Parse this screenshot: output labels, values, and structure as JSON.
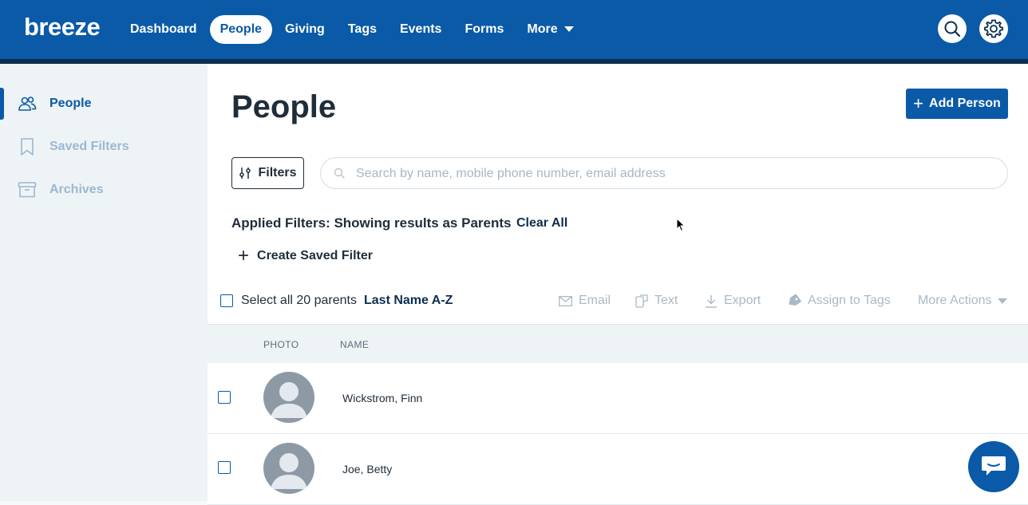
{
  "header": {
    "logo": "breeze",
    "nav": [
      {
        "label": "Dashboard",
        "active": false
      },
      {
        "label": "People",
        "active": true
      },
      {
        "label": "Giving",
        "active": false
      },
      {
        "label": "Tags",
        "active": false
      },
      {
        "label": "Events",
        "active": false
      },
      {
        "label": "Forms",
        "active": false
      },
      {
        "label": "More",
        "active": false
      }
    ],
    "icons": [
      "search-icon",
      "gear-icon"
    ]
  },
  "sidebar": {
    "items": [
      {
        "label": "People",
        "icon": "people-icon",
        "active": true
      },
      {
        "label": "Saved Filters",
        "icon": "bookmark-icon",
        "active": false
      },
      {
        "label": "Archives",
        "icon": "archive-box-icon",
        "active": false
      }
    ]
  },
  "main": {
    "title": "People",
    "add_button": "Add Person",
    "filters_button": "Filters",
    "search": {
      "placeholder": "Search by name, mobile phone number, email address",
      "value": ""
    },
    "applied_filters": "Applied Filters: Showing results as Parents",
    "clear_all": "Clear All",
    "create_saved_filter": "Create Saved Filter",
    "select_all": "Select all 20 parents",
    "sort": "Last Name A-Z",
    "actions": {
      "email": "Email",
      "text": "Text",
      "export": "Export",
      "assign_tags": "Assign to Tags",
      "more_actions": "More Actions"
    },
    "table": {
      "columns": [
        "PHOTO",
        "NAME"
      ],
      "rows": [
        {
          "name": "Wickstrom, Finn"
        },
        {
          "name": "Joe, Betty"
        }
      ]
    }
  },
  "colors": {
    "brand": "#0a5aa8",
    "brand_dark": "#0c2e4f",
    "muted": "#a9b9c6"
  }
}
